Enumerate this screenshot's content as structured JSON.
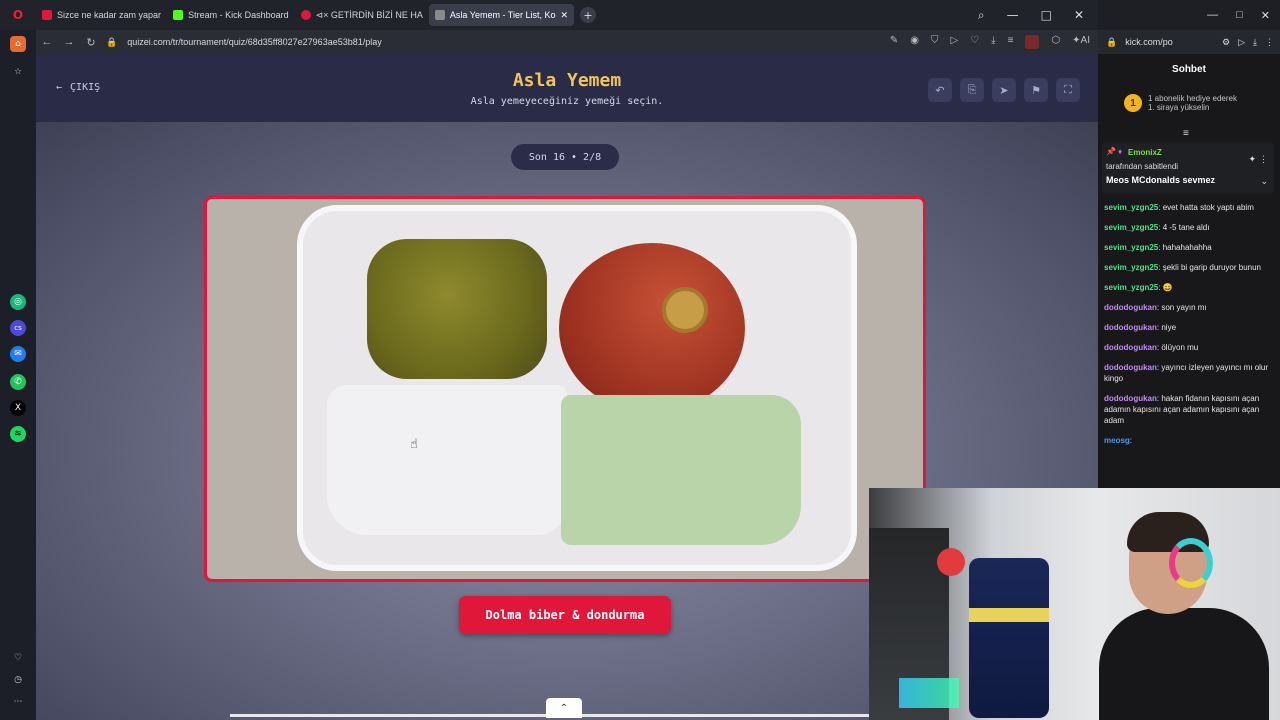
{
  "browser": {
    "tabs": [
      {
        "label": "Sizce ne kadar zam yapar",
        "color": "#e0163a"
      },
      {
        "label": "Stream - Kick Dashboard",
        "color": "#53fc18"
      },
      {
        "label": "⊲× GETİRDİN BİZİ NE HA",
        "color": "#e0163a"
      },
      {
        "label": "Asla Yemem - Tier List, Ko",
        "color": "#8a8a8a"
      }
    ],
    "url": "quizei.com/tr/tournament/quiz/68d35ff8027e27963ae53b81/play"
  },
  "quiz": {
    "exit_label": "ÇIKIŞ",
    "title": "Asla Yemem",
    "subtitle": "Asla yemeyeceğiniz yemeği seçin.",
    "round": "Son 16 • 2/8",
    "choice_label": "Dolma biber & dondurma"
  },
  "chat": {
    "url": "kick.com/po",
    "title": "Sohbet",
    "sub_gift_line1": "1 abonelik hediye ederek",
    "sub_gift_line2": "1. siraya yükselin",
    "coin": "1",
    "pinned_user": "EmonixZ",
    "pinned_by": "tarafından sabitlendi",
    "pinned_message": "Meos MCdonalds sevmez",
    "messages": [
      {
        "user": "sevim_yzgn25",
        "text": ": evet hatta stok yaptı abim",
        "color": "#53e08a"
      },
      {
        "user": "sevim_yzgn25",
        "text": ": 4 -5 tane aldı",
        "color": "#53e08a"
      },
      {
        "user": "sevim_yzgn25",
        "text": ": hahahahahha",
        "color": "#53e08a"
      },
      {
        "user": "sevim_yzgn25",
        "text": ": şekli bi garip duruyor bunun",
        "color": "#53e08a"
      },
      {
        "user": "sevim_yzgn25",
        "text": ": 😄",
        "color": "#53e08a"
      },
      {
        "user": "dododogukan",
        "text": ": son yayın mı",
        "color": "#c28cf0"
      },
      {
        "user": "dododogukan",
        "text": ": niye",
        "color": "#c28cf0"
      },
      {
        "user": "dododogukan",
        "text": ": ölüyon mu",
        "color": "#c28cf0"
      },
      {
        "user": "dododogukan",
        "text": ": yayıncı izleyen yayıncı mı olur kingo",
        "color": "#c28cf0"
      },
      {
        "user": "dododogukan",
        "text": ": hakan fidanın kapısını açan adamın kapısını açan adamın kapısını açan adam",
        "color": "#c28cf0"
      },
      {
        "user": "meosg",
        "text": ":",
        "color": "#4a9be8"
      }
    ]
  }
}
